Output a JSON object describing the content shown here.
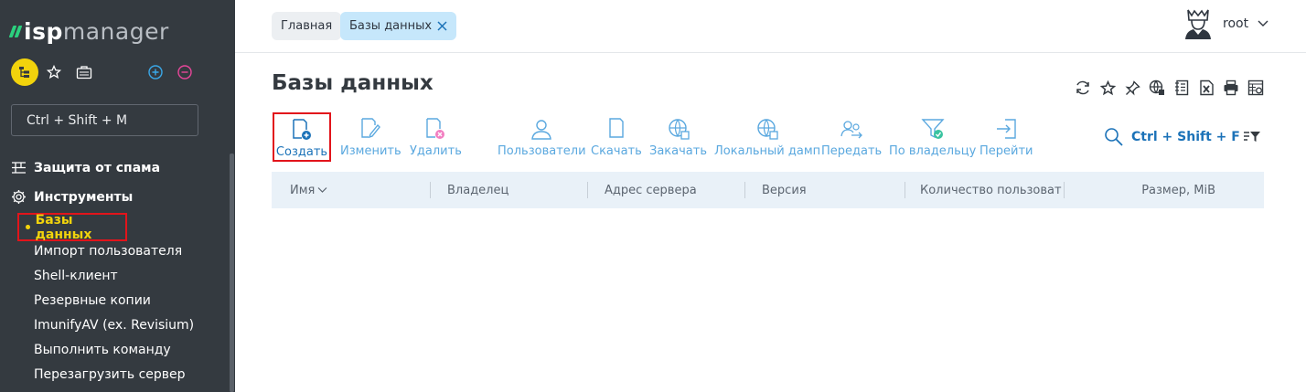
{
  "app": {
    "logo_isp": "isp",
    "logo_manager": "manager"
  },
  "sidebar": {
    "search_placeholder": "Ctrl + Shift + M",
    "groups": [
      {
        "label": "Защита от спама",
        "icon": "spam-protection-icon"
      },
      {
        "label": "Инструменты",
        "icon": "gear-icon"
      }
    ],
    "active_item": "Базы данных",
    "items": [
      "Импорт пользователя",
      "Shell-клиент",
      "Резервные копии",
      "ImunifyAV (ex. Revisium)",
      "Выполнить команду",
      "Перезагрузить сервер"
    ]
  },
  "header": {
    "breadcrumb_home": "Главная",
    "breadcrumb_current": "Базы данных",
    "user": "root"
  },
  "page": {
    "title": "Базы данных"
  },
  "toolbar": {
    "create": "Создать",
    "edit": "Изменить",
    "delete": "Удалить",
    "users": "Пользователи",
    "download": "Скачать",
    "upload": "Закачать",
    "local_dump": "Локальный дамп",
    "transfer": "Передать",
    "by_owner": "По владельцу",
    "goto": "Перейти"
  },
  "table": {
    "search_hint": "Ctrl + Shift + F",
    "columns": [
      "Имя",
      "Владелец",
      "Адрес сервера",
      "Версия",
      "Количество пользователей",
      "Размер, MiB"
    ],
    "rows": []
  },
  "colors": {
    "sidebar_bg": "#343a40",
    "accent_yellow": "#f2d30c",
    "accent_blue": "#1b72b8",
    "highlight_red": "#e2141b",
    "logo_green": "#2bd17e"
  }
}
